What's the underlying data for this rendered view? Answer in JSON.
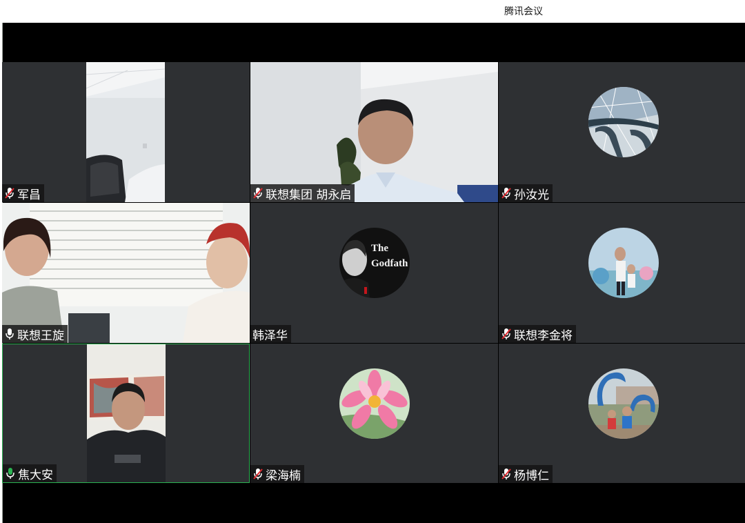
{
  "app": {
    "title": "腾讯会议"
  },
  "participants": [
    {
      "name": "军昌",
      "mic": "muted"
    },
    {
      "name": "联想集团 胡永启",
      "mic": "muted"
    },
    {
      "name": "孙汝光",
      "mic": "muted"
    },
    {
      "name": "联想王旋",
      "mic": "on"
    },
    {
      "name": "韩泽华",
      "mic": "none"
    },
    {
      "name": "联想李金将",
      "mic": "muted"
    },
    {
      "name": "焦大安",
      "mic": "on"
    },
    {
      "name": "梁海楠",
      "mic": "muted"
    },
    {
      "name": "杨博仁",
      "mic": "muted"
    }
  ],
  "avatar_text": {
    "godfather_line1": "The",
    "godfather_line2": "Godfath"
  },
  "colors": {
    "tile_bg": "#2e3033",
    "active_border": "#2bb352",
    "muted_red": "#e0282e",
    "stage_bg": "#000000"
  }
}
